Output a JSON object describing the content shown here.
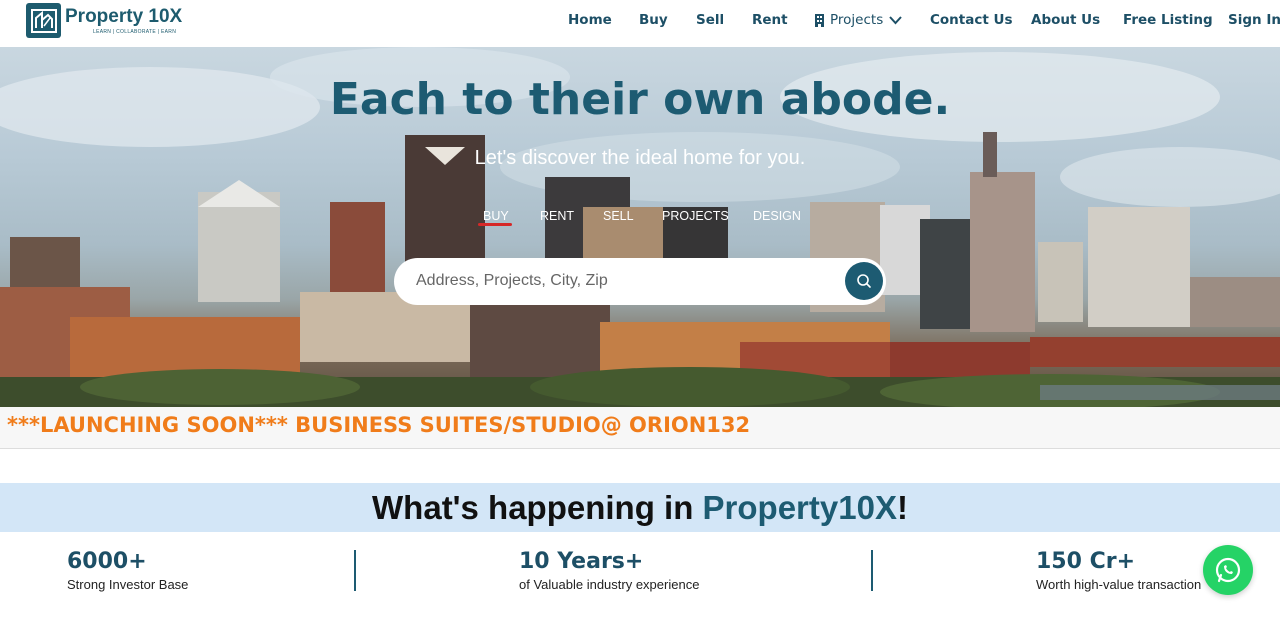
{
  "brand": {
    "name": "Property 10X",
    "tagline": "LEARN | COLLABORATE | EARN",
    "color": "#1d5b6e"
  },
  "nav": {
    "items": [
      "Home",
      "Buy",
      "Sell",
      "Rent",
      "Projects",
      "Contact Us",
      "About Us",
      "Free Listing",
      "Sign In"
    ]
  },
  "hero": {
    "title": "Each to their own abode.",
    "subtitle": "Let's discover the ideal home for you.",
    "tabs": [
      "BUY",
      "RENT",
      "SELL",
      "PROJECTS",
      "DESIGN"
    ],
    "active_tab": "BUY",
    "search": {
      "placeholder": "Address, Projects, City, Zip",
      "value": ""
    }
  },
  "marquee": {
    "text": "***LAUNCHING SOON*** BUSINESS SUITES/STUDIO@ ORION132",
    "color": "#f07c1a"
  },
  "happening": {
    "prefix": "What's happening in ",
    "brand": "Property10X",
    "suffix": "!"
  },
  "stats": [
    {
      "value": "6000+",
      "label": "Strong Investor Base"
    },
    {
      "value": "10 Years+",
      "label": "of Valuable industry experience"
    },
    {
      "value": "150 Cr+",
      "label": "Worth high-value transaction"
    }
  ],
  "icons": {
    "logo": "house-logo-icon",
    "projects": "building-icon",
    "dropdown": "chevron-down-icon",
    "search": "search-icon",
    "chat": "whatsapp-icon"
  }
}
